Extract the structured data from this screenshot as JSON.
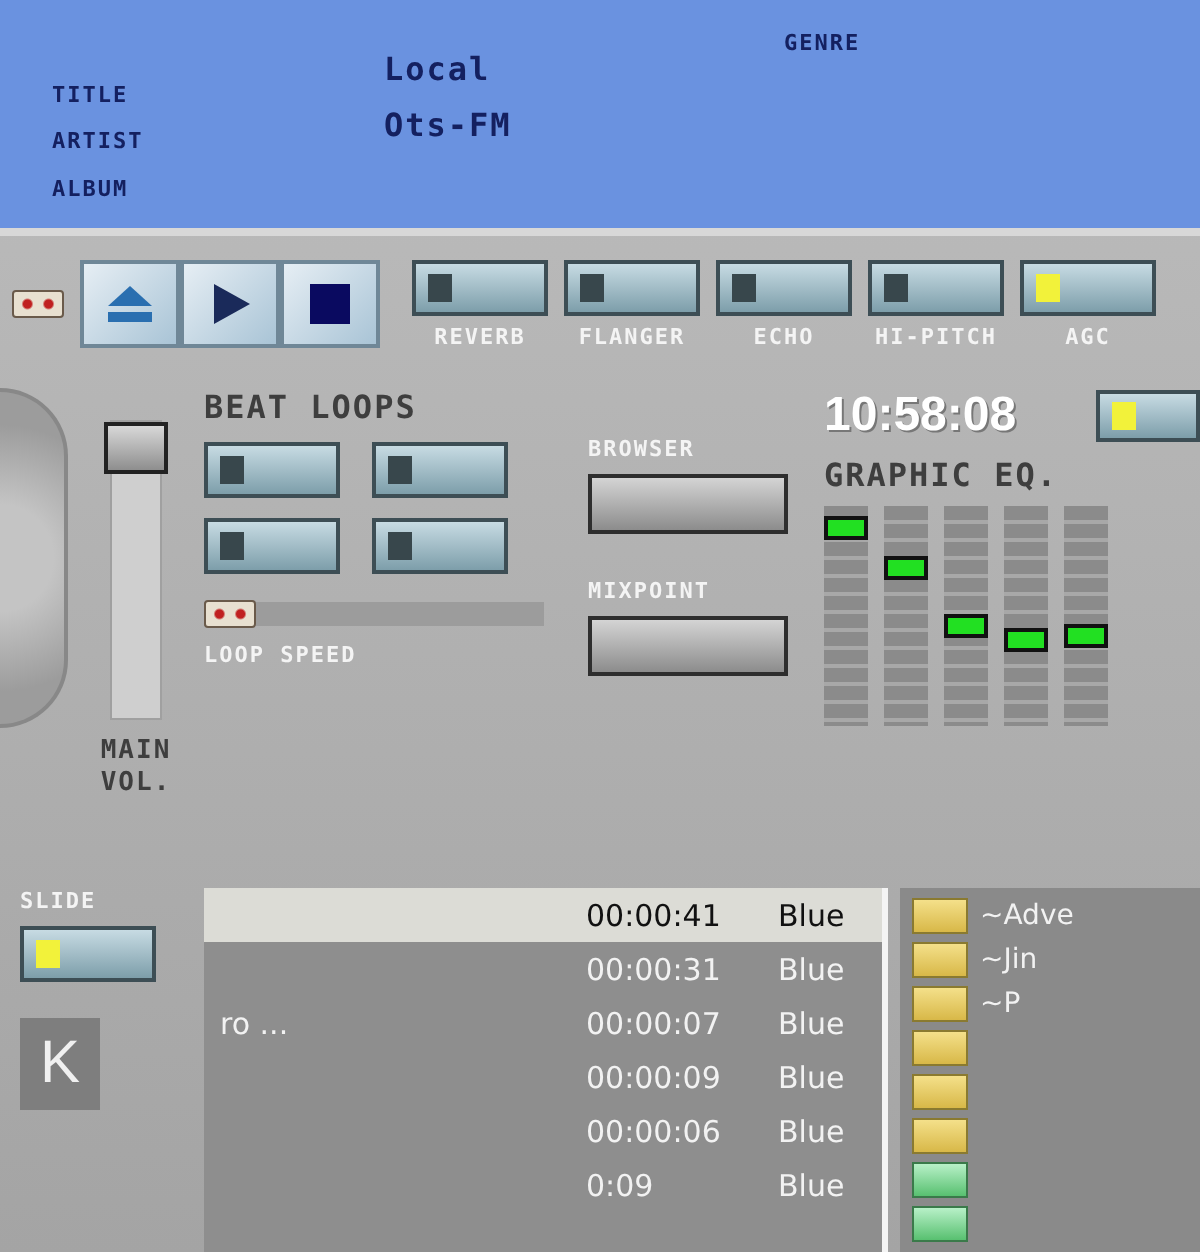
{
  "info": {
    "labels": [
      "TITLE",
      "ARTIST",
      "ALBUM"
    ],
    "lines": [
      "Local",
      "Ots-FM"
    ],
    "genre_label": "GENRE"
  },
  "transport": [
    {
      "kind": "eject"
    },
    {
      "kind": "play"
    },
    {
      "kind": "stop"
    }
  ],
  "effects": [
    {
      "label": "REVERB",
      "on": false
    },
    {
      "label": "FLANGER",
      "on": false
    },
    {
      "label": "ECHO",
      "on": false
    },
    {
      "label": "HI-PITCH",
      "on": false
    },
    {
      "label": "AGC",
      "on": true
    }
  ],
  "clock": "10:58:08",
  "extra_toggle": {
    "on": true
  },
  "beat_loops": {
    "label": "BEAT LOOPS",
    "toggles": [
      {
        "on": false
      },
      {
        "on": false
      },
      {
        "on": false
      },
      {
        "on": false
      }
    ]
  },
  "loop_speed": {
    "label": "LOOP SPEED",
    "level": 0
  },
  "main_volume": {
    "label": "MAIN VOL.",
    "level": 1
  },
  "slide": {
    "label": "SLIDE",
    "on": true
  },
  "deck_button": {
    "label": "K"
  },
  "browser": {
    "label": "BROWSER"
  },
  "mixpoint": {
    "label": "MIXPOINT"
  },
  "equalizer": {
    "label": "GRAPHIC EQ.",
    "bands": [
      {
        "level": 0.95
      },
      {
        "level": 0.75
      },
      {
        "level": 0.45
      },
      {
        "level": 0.38
      },
      {
        "level": 0.4
      }
    ]
  },
  "playlist": {
    "rows": [
      {
        "time": "00:00:41",
        "artist": "Blue",
        "selected": true
      },
      {
        "time": "00:00:31",
        "artist": "Blue",
        "selected": false
      },
      {
        "title": "ro ...",
        "time": "00:00:07",
        "artist": "Blue",
        "selected": false
      },
      {
        "time": "00:00:09",
        "artist": "Blue",
        "selected": false
      },
      {
        "time": "00:00:06",
        "artist": "Blue",
        "selected": false
      },
      {
        "time": "0:09",
        "artist": "Blue",
        "selected": false
      }
    ]
  },
  "library": [
    {
      "kind": "folder",
      "label": "~Adve"
    },
    {
      "kind": "folder",
      "label": "~Jin"
    },
    {
      "kind": "folder",
      "label": "~P"
    },
    {
      "kind": "folder"
    },
    {
      "kind": "folder"
    },
    {
      "kind": "folder"
    },
    {
      "kind": "playlist"
    },
    {
      "kind": "playlist"
    }
  ]
}
